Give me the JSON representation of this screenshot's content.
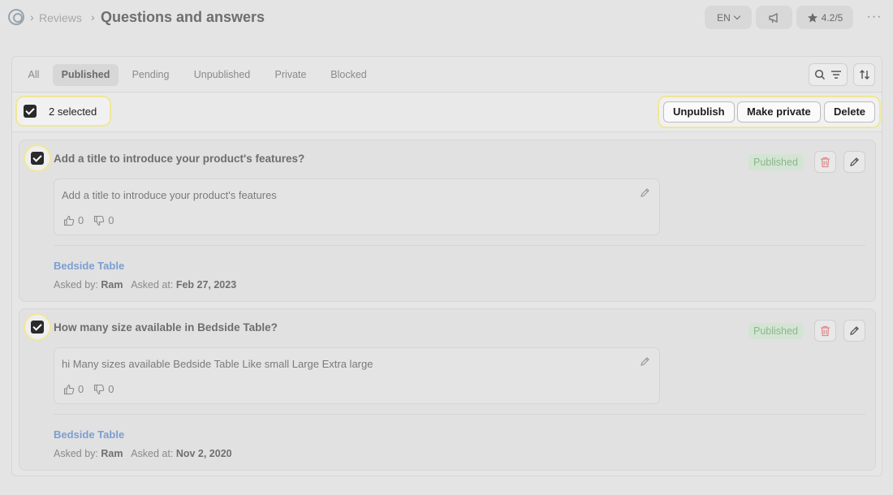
{
  "breadcrumb": {
    "parent": "Reviews",
    "current": "Questions and answers"
  },
  "header_actions": {
    "language": "EN",
    "rating": "4.2/5",
    "more": "···"
  },
  "tabs": [
    "All",
    "Published",
    "Pending",
    "Unpublished",
    "Private",
    "Blocked"
  ],
  "active_tab": "Published",
  "bulk": {
    "selected_label": "2 selected",
    "actions": [
      "Unpublish",
      "Make private",
      "Delete"
    ]
  },
  "labels": {
    "asked_by": "Asked by:",
    "asked_at": "Asked at:"
  },
  "questions": [
    {
      "question": "Add a title to introduce your product's features?",
      "status": "Published",
      "answer": "Add a title to introduce your product's features",
      "upvotes": "0",
      "downvotes": "0",
      "product": "Bedside Table",
      "asked_by": "Ram",
      "asked_at": "Feb 27, 2023",
      "checked": true
    },
    {
      "question": "How many size available in Bedside Table?",
      "status": "Published",
      "answer": "hi Many sizes available Bedside Table Like small Large Extra large",
      "upvotes": "0",
      "downvotes": "0",
      "product": "Bedside Table",
      "asked_by": "Ram",
      "asked_at": "Nov 2, 2020",
      "checked": true
    }
  ],
  "colors": {
    "highlight": "#f0e79a",
    "status_green": "#8db58d",
    "link_blue": "#7b9ed0",
    "delete_red": "#e08a8a"
  }
}
